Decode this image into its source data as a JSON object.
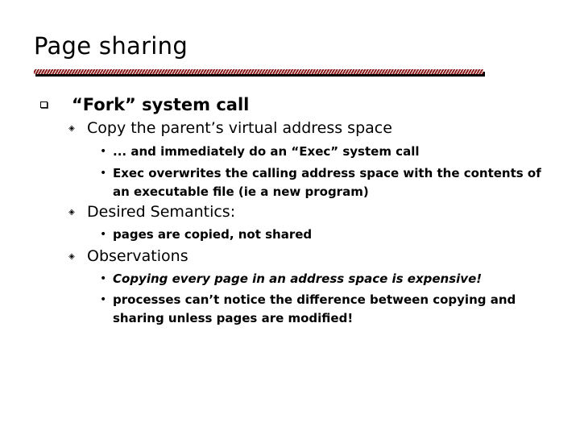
{
  "slide": {
    "title": "Page sharing",
    "bullets": {
      "fork": {
        "icon": "hollow-square-bullet",
        "text": "“Fork” system call"
      },
      "copy": {
        "icon": "diamond-bullet",
        "text": "Copy the parent’s virtual address space",
        "sub": [
          {
            "icon": "dot-bullet",
            "text": "... and immediately do an “Exec” system call"
          },
          {
            "icon": "dot-bullet",
            "text": "Exec overwrites the calling address space with the contents of an executable file (ie a new program)"
          }
        ]
      },
      "desired": {
        "icon": "diamond-bullet",
        "text": "Desired Semantics:",
        "sub": [
          {
            "icon": "dot-bullet",
            "text": "pages are copied, not shared"
          }
        ]
      },
      "observations": {
        "icon": "diamond-bullet",
        "text": "Observations",
        "sub": [
          {
            "icon": "dot-bullet",
            "text": "Copying every page in an address space is expensive!"
          },
          {
            "icon": "dot-bullet",
            "text": "processes can’t notice the difference between copying and sharing unless pages are modified!"
          }
        ]
      }
    },
    "colors": {
      "rule": "#8b1a1a",
      "rule_shadow": "#000000",
      "text": "#000000",
      "background": "#ffffff"
    }
  },
  "glyphs": {
    "diamond": "◈",
    "dot": "•"
  }
}
